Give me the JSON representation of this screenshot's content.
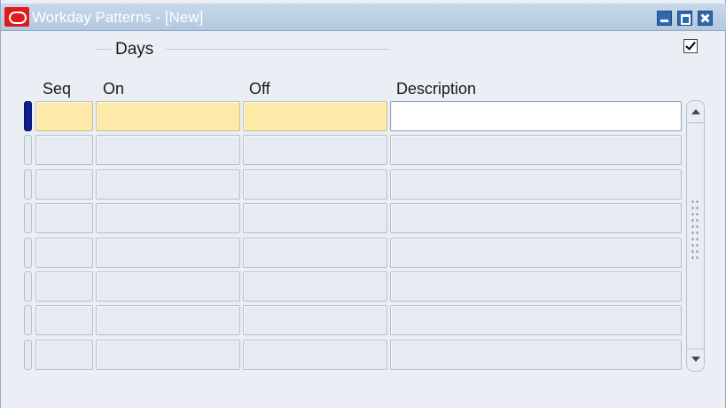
{
  "window": {
    "title": "Workday Patterns - [New]"
  },
  "section": {
    "label": "Days",
    "checkbox_checked": true
  },
  "table": {
    "columns": [
      "Seq",
      "On",
      "Off",
      "Description"
    ],
    "rows": [
      {
        "seq": "",
        "on": "",
        "off": "",
        "description": ""
      },
      {
        "seq": "",
        "on": "",
        "off": "",
        "description": ""
      },
      {
        "seq": "",
        "on": "",
        "off": "",
        "description": ""
      },
      {
        "seq": "",
        "on": "",
        "off": "",
        "description": ""
      },
      {
        "seq": "",
        "on": "",
        "off": "",
        "description": ""
      },
      {
        "seq": "",
        "on": "",
        "off": "",
        "description": ""
      },
      {
        "seq": "",
        "on": "",
        "off": "",
        "description": ""
      },
      {
        "seq": "",
        "on": "",
        "off": "",
        "description": ""
      }
    ],
    "current_row": 0
  },
  "colors": {
    "current_row_fill": "#fde9a8",
    "row_indicator_active": "#0e1e8a",
    "titlebar": "#b3c9df",
    "app_icon": "#e01b1b"
  },
  "icons": {
    "app": "oracle-logo-icon",
    "minimize": "minimize-icon",
    "maximize": "maximize-icon",
    "close": "close-icon",
    "scroll_up": "scroll-up-arrow-icon",
    "scroll_down": "scroll-down-arrow-icon"
  }
}
